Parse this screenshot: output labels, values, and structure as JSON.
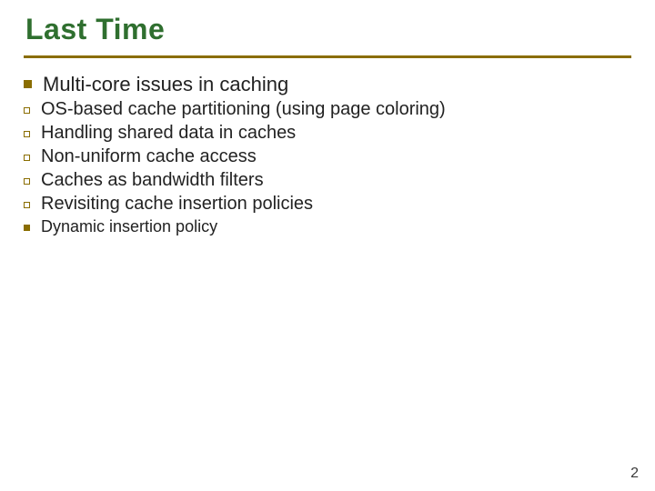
{
  "slide": {
    "title": "Last Time",
    "page_number": "2",
    "body": {
      "heading": "Multi-core issues in caching",
      "items": [
        "OS-based cache partitioning (using page coloring)",
        "Handling shared data in caches",
        "Non-uniform cache access",
        "Caches as bandwidth filters",
        "Revisiting cache insertion policies"
      ],
      "subitem": "Dynamic insertion policy"
    }
  }
}
